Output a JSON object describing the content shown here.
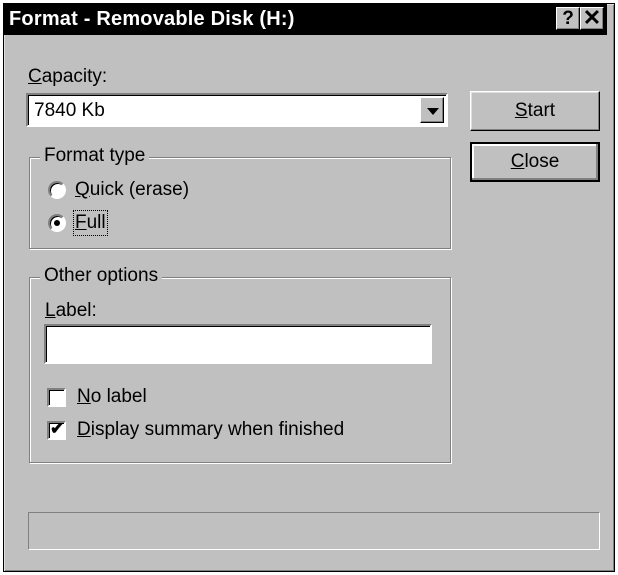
{
  "window": {
    "title": "Format - Removable Disk (H:)",
    "help_button": "?",
    "close_button": "✕"
  },
  "capacity": {
    "label_pre": "",
    "label_u": "C",
    "label_post": "apacity:",
    "value": "7840 Kb"
  },
  "buttons": {
    "start_u": "S",
    "start_post": "tart",
    "close_u": "C",
    "close_post": "lose"
  },
  "format_type": {
    "legend": "Format type",
    "options": [
      {
        "u": "Q",
        "post": "uick (erase)",
        "checked": false
      },
      {
        "u": "F",
        "post": "ull",
        "checked": true
      }
    ]
  },
  "other_options": {
    "legend": "Other options",
    "label_u": "L",
    "label_post": "abel:",
    "label_value": "",
    "no_label_u": "N",
    "no_label_post": "o label",
    "no_label_checked": false,
    "summary_u": "D",
    "summary_post": "isplay summary when finished",
    "summary_checked": true
  },
  "status_bar": {
    "text": ""
  }
}
